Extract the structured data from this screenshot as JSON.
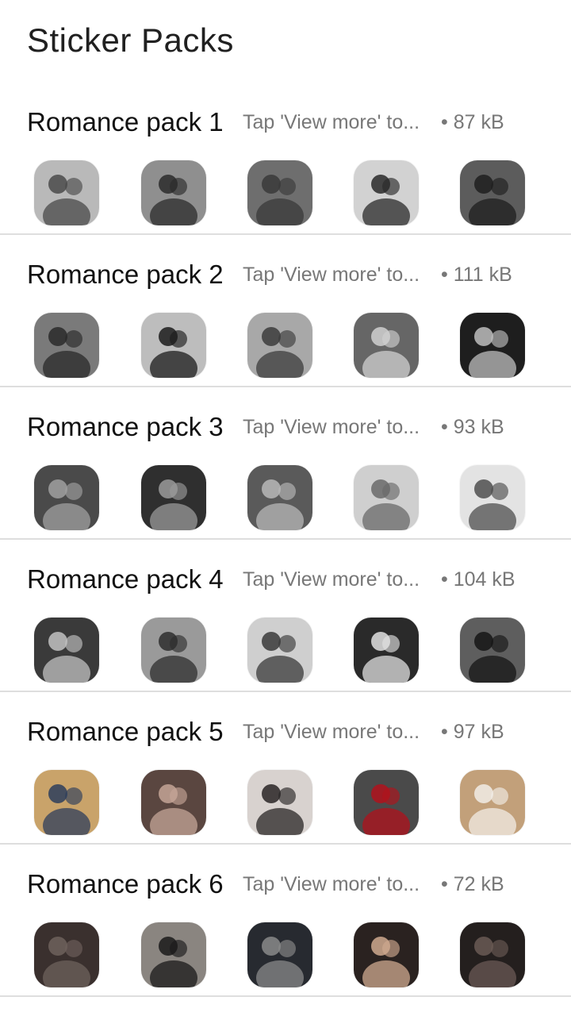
{
  "header": {
    "title": "Sticker Packs"
  },
  "packs": [
    {
      "name": "Romance pack 1",
      "description": "Tap 'View more' to...",
      "size": "• 87 kB",
      "stickers": [
        {
          "label": "couple-sticker",
          "bg": "#b9b9b9",
          "fg": "#4a4a4a"
        },
        {
          "label": "couple-sticker",
          "bg": "#8f8f8f",
          "fg": "#2b2b2b"
        },
        {
          "label": "couple-sticker",
          "bg": "#6e6e6e",
          "fg": "#3a3a3a"
        },
        {
          "label": "couple-sticker",
          "bg": "#d2d2d2",
          "fg": "#2a2a2a"
        },
        {
          "label": "couple-sticker",
          "bg": "#5c5c5c",
          "fg": "#1e1e1e"
        }
      ]
    },
    {
      "name": "Romance pack 2",
      "description": "Tap 'View more' to...",
      "size": "• 111 kB",
      "stickers": [
        {
          "label": "couple-sticker",
          "bg": "#7a7a7a",
          "fg": "#2a2a2a"
        },
        {
          "label": "couple-sticker",
          "bg": "#bdbdbd",
          "fg": "#1c1c1c"
        },
        {
          "label": "couple-sticker",
          "bg": "#a8a8a8",
          "fg": "#3c3c3c"
        },
        {
          "label": "couple-sticker",
          "bg": "#666666",
          "fg": "#d0d0d0"
        },
        {
          "label": "couple-sticker",
          "bg": "#1e1e1e",
          "fg": "#bdbdbd"
        }
      ]
    },
    {
      "name": "Romance pack 3",
      "description": "Tap 'View more' to...",
      "size": "• 93 kB",
      "stickers": [
        {
          "label": "couple-sticker",
          "bg": "#4a4a4a",
          "fg": "#a0a0a0"
        },
        {
          "label": "couple-sticker",
          "bg": "#2f2f2f",
          "fg": "#9a9a9a"
        },
        {
          "label": "couple-sticker",
          "bg": "#5a5a5a",
          "fg": "#b8b8b8"
        },
        {
          "label": "couple-sticker",
          "bg": "#cfcfcf",
          "fg": "#6a6a6a"
        },
        {
          "label": "couple-sticker",
          "bg": "#e3e3e3",
          "fg": "#4f4f4f"
        }
      ]
    },
    {
      "name": "Romance pack 4",
      "description": "Tap 'View more' to...",
      "size": "• 104 kB",
      "stickers": [
        {
          "label": "couple-sticker",
          "bg": "#3a3a3a",
          "fg": "#c2c2c2"
        },
        {
          "label": "couple-sticker",
          "bg": "#9a9a9a",
          "fg": "#2e2e2e"
        },
        {
          "label": "couple-sticker",
          "bg": "#cfcfcf",
          "fg": "#3a3a3a"
        },
        {
          "label": "couple-sticker",
          "bg": "#2a2a2a",
          "fg": "#e0e0e0"
        },
        {
          "label": "couple-sticker",
          "bg": "#5e5e5e",
          "fg": "#151515"
        }
      ]
    },
    {
      "name": "Romance pack 5",
      "description": "Tap 'View more' to...",
      "size": "• 97 kB",
      "stickers": [
        {
          "label": "couple-sticker",
          "bg": "#c9a36a",
          "fg": "#2d3e5c"
        },
        {
          "label": "couple-sticker",
          "bg": "#5a4640",
          "fg": "#c4a597"
        },
        {
          "label": "couple-sticker",
          "bg": "#d8d2cf",
          "fg": "#2a2626"
        },
        {
          "label": "couple-sticker",
          "bg": "#4a4a4a",
          "fg": "#b0121c"
        },
        {
          "label": "couple-sticker",
          "bg": "#c2a07a",
          "fg": "#f1ece6"
        }
      ]
    },
    {
      "name": "Romance pack 6",
      "description": "Tap 'View more' to...",
      "size": "• 72 kB",
      "stickers": [
        {
          "label": "couple-sticker",
          "bg": "#3a302e",
          "fg": "#6e615c"
        },
        {
          "label": "couple-sticker",
          "bg": "#8a8580",
          "fg": "#1a1a1a"
        },
        {
          "label": "couple-sticker",
          "bg": "#272a30",
          "fg": "#8a8a8a"
        },
        {
          "label": "couple-sticker",
          "bg": "#2a2220",
          "fg": "#cfa98f"
        },
        {
          "label": "couple-sticker",
          "bg": "#241f1e",
          "fg": "#6a5a55"
        }
      ]
    }
  ]
}
